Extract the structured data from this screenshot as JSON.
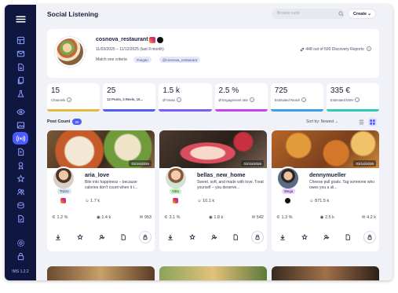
{
  "app": {
    "title": "Social Listening",
    "version": "IMS 1.2.2"
  },
  "search": {
    "placeholder": "Browse suite"
  },
  "create": {
    "label": "Create"
  },
  "sidebar": {
    "icons": [
      "menu-icon",
      "grid-icon",
      "mail-icon",
      "document-icon",
      "copy-icon",
      "flask-icon",
      "eye-icon",
      "image-icon",
      "broadcast-icon",
      "file-user-icon",
      "user-badge-icon",
      "star-icon",
      "users-icon",
      "coin-icon",
      "document-check-icon",
      "settings-icon",
      "lock-icon"
    ],
    "active": "broadcast-icon"
  },
  "profile": {
    "name": "cosnova_restaurant",
    "date_range": "11/03/2025 – 11/12/2025",
    "period": "(last 9 month)",
    "match_label": "Match one criteria",
    "tags": [
      "#vegan",
      "@cosnova_restaurant"
    ],
    "reports": "448 out of 500 Discovery Reports"
  },
  "stats": [
    {
      "value": "15",
      "label": "Channels",
      "color": "#e7b93a"
    },
    {
      "value": "25",
      "label": "12 Posts, 3 Reels, 10...",
      "color": "#4c5bff"
    },
    {
      "value": "1.5 k",
      "label": "Ø Views",
      "color": "#7b5cf6"
    },
    {
      "value": "2.5 %",
      "label": "Ø Engagement rate",
      "color": "#c047f0"
    },
    {
      "value": "725",
      "label": "Estimated Reach",
      "color": "#3aa0e8"
    },
    {
      "value": "335 €",
      "label": "Estimated EMV",
      "color": "#2fc8c0"
    }
  ],
  "posts_bar": {
    "label": "Post Count",
    "count": "25",
    "sort": "Sort by: Newest"
  },
  "cards": [
    {
      "name": "aria_love",
      "tag": "Trizzo",
      "tag_color": "#d9e7f4",
      "date": "03/16/2026",
      "desc": "Bite into happiness – because calories don't count when it t...",
      "platform": "instagram",
      "followers": "1.7 k",
      "er": "1.2 %",
      "views": "1.4 k",
      "comments": "953"
    },
    {
      "name": "bellas_new_home",
      "tag": "Vitra",
      "tag_color": "#c9f0c0",
      "date": "03/15/2026",
      "desc": "Sweet, soft, and made with love. Treat yourself – you deserve...",
      "platform": "instagram",
      "followers": "10.1 k",
      "er": "3.1 %",
      "views": "1.8 k",
      "comments": "542"
    },
    {
      "name": "dennymueller",
      "tag": "Wega",
      "tag_color": "#e9d3ff",
      "date": "03/14/2026",
      "desc": "Cheese pull goals. Tag someone who owes you a sli...",
      "platform": "tiktok",
      "followers": "871.5 k",
      "er": "1.3 %",
      "views": "2.5 k",
      "comments": "4.2 k"
    }
  ]
}
